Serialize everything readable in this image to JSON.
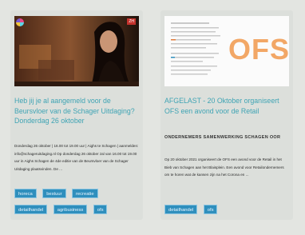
{
  "cards": [
    {
      "title": "Heb jij je al aangemeld voor de Beursvloer van de Schager Uitdaging? Donderdag 26 oktober",
      "excerpt": "Donderdag 26 oktober | 16.00 tot 19.00 uur | Aighs te Schagen | aanmelden: info@schageruitdaging.nl Op donderdag 26 oktober zal van 16.00 tot 19.00 uur in Aighs Schagen de 4de editie van de Beursvloer van de Schager Uitdaging plaatsvinden. De ...",
      "tags": [
        [
          "horeca",
          "bestuur",
          "recreatie"
        ],
        [
          "detailhandel",
          "agribusiness",
          "ofs"
        ]
      ],
      "photo": {
        "alt": "Woman speaking at event",
        "badge": "ZH"
      }
    },
    {
      "title": "AFGELAST - 20 Oktober organiseert OFS een avond voor de Retail",
      "subtitle": "ONDERNEMERS SAMENWERKING SCHAGEN OOR",
      "excerpt": "Op 20 oktober 2021 organiseert de OFS een avond voor de Retail in het Bieb van Schagen aan het Blaisplein. Een avond voor Retailondernemers om te horen wat de kansen zijn na het Corona en ...",
      "tags": [
        [
          "detailhandel",
          "ofs"
        ]
      ],
      "logo_text": "OFS"
    }
  ]
}
